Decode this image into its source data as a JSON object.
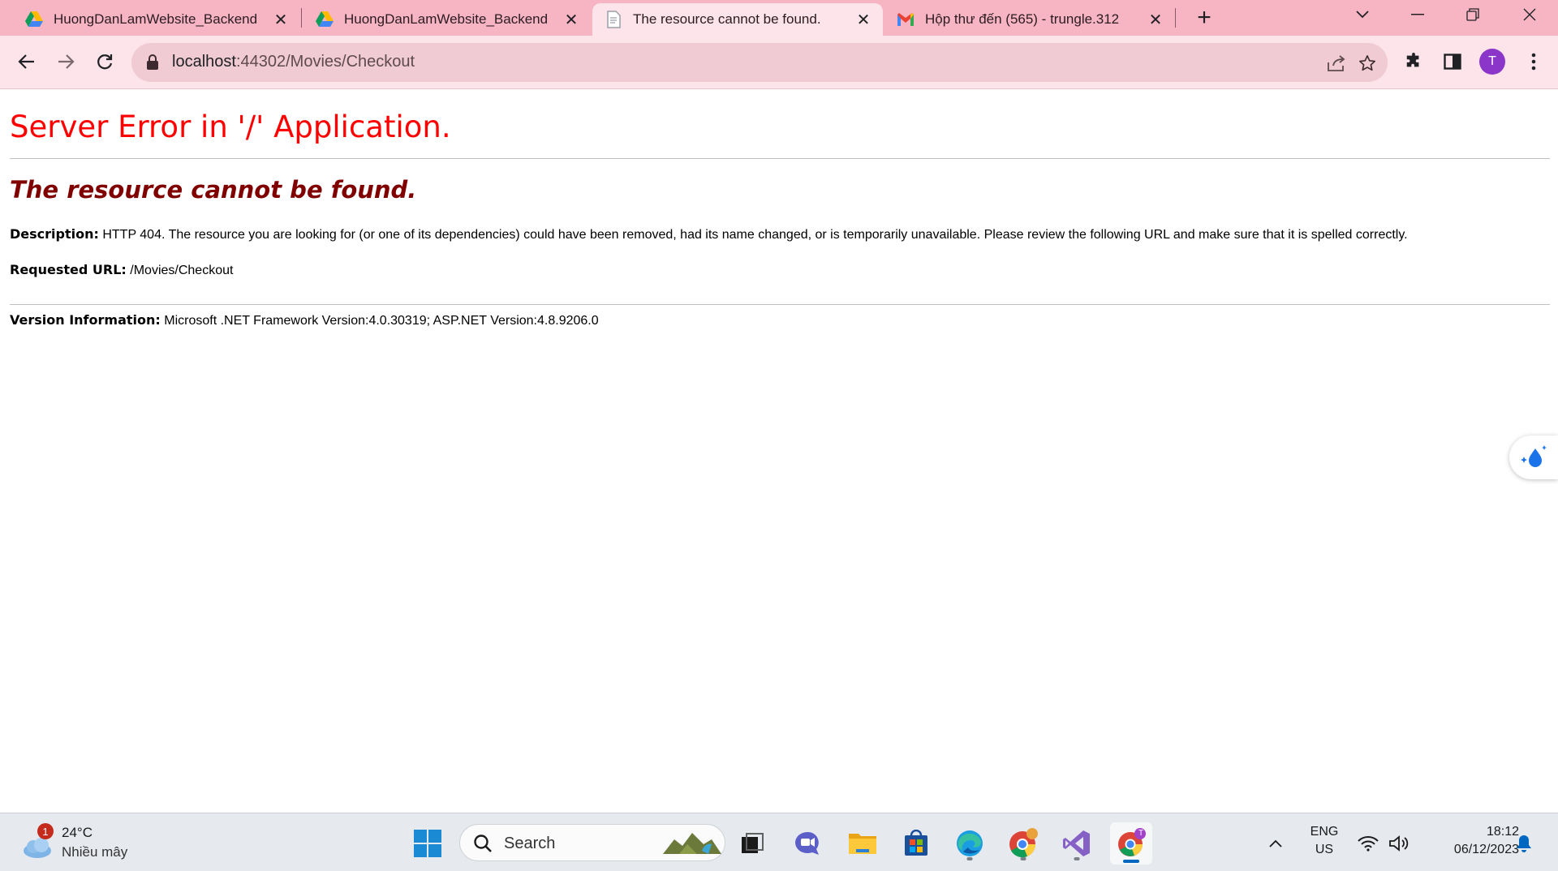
{
  "browser": {
    "tabs": [
      {
        "title": "HuongDanLamWebsite_Backend",
        "icon": "google-drive-icon",
        "active": false
      },
      {
        "title": "HuongDanLamWebsite_Backend",
        "icon": "google-drive-icon",
        "active": false
      },
      {
        "title": "The resource cannot be found.",
        "icon": "blank-page-icon",
        "active": true
      },
      {
        "title": "Hộp thư đến (565) - trungle.312",
        "icon": "gmail-icon",
        "active": false
      }
    ],
    "url_host": "localhost",
    "url_rest": ":44302/Movies/Checkout",
    "profile_initial": "T",
    "colors": {
      "tabstrip": "#f7b4c3",
      "toolbar": "#fde3ea",
      "omnibox": "#f0cbd4",
      "avatar": "#8b35c9"
    }
  },
  "page": {
    "heading": "Server Error in '/' Application.",
    "subheading": "The resource cannot be found.",
    "description_label": "Description:",
    "description_text": "HTTP 404. The resource you are looking for (or one of its dependencies) could have been removed, had its name changed, or is temporarily unavailable.  Please review the following URL and make sure that it is spelled correctly.",
    "url_label": "Requested URL:",
    "url_value": "/Movies/Checkout",
    "version_label": "Version Information:",
    "version_value": "Microsoft .NET Framework Version:4.0.30319; ASP.NET Version:4.8.9206.0",
    "colors": {
      "heading": "#ff0000",
      "subheading": "#800000"
    }
  },
  "taskbar": {
    "weather_temp": "24°C",
    "weather_desc": "Nhiều mây",
    "weather_badge": "1",
    "search_placeholder": "Search",
    "lang_top": "ENG",
    "lang_bottom": "US",
    "time": "18:12",
    "date": "06/12/2023",
    "chrome_badge": "T",
    "apps": [
      "start-icon",
      "task-view-icon",
      "teams-chat-icon",
      "file-explorer-icon",
      "microsoft-store-icon",
      "edge-icon",
      "chrome-icon",
      "visual-studio-icon",
      "chrome-profile-icon"
    ]
  }
}
